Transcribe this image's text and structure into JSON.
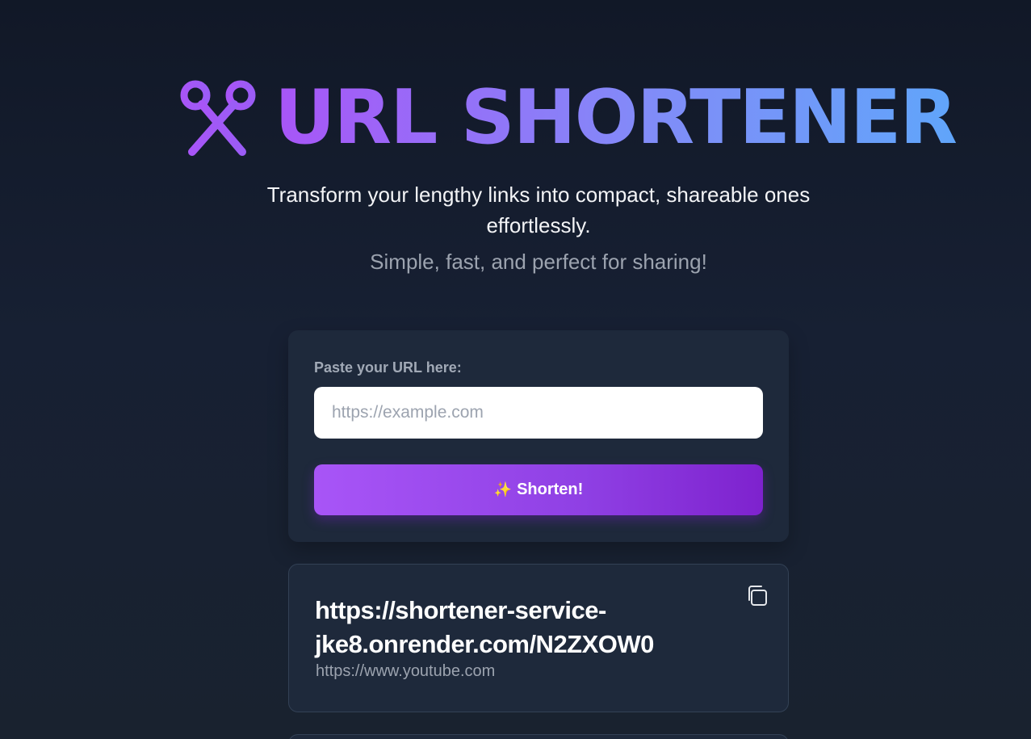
{
  "header": {
    "title": "URL SHORTENER",
    "title_icon": "scissors-icon",
    "subtitle": "Transform your lengthy links into compact, shareable ones effortlessly.",
    "tagline": "Simple, fast, and perfect for sharing!"
  },
  "form": {
    "label": "Paste your URL here:",
    "input_value": "",
    "input_placeholder": "https://example.com",
    "button_icon": "sparkles-icon",
    "button_label": "Shorten!"
  },
  "results": [
    {
      "short_url": "https://shortener-service-jke8.onrender.com/N2ZXOW0",
      "original_url": "https://www.youtube.com",
      "copy_icon": "copy-icon"
    }
  ],
  "colors": {
    "accent_purple": "#a855f7",
    "accent_blue": "#60a5fa",
    "button_dark": "#7e22ce",
    "card_bg": "#1e293b",
    "page_bg": "#111827"
  }
}
